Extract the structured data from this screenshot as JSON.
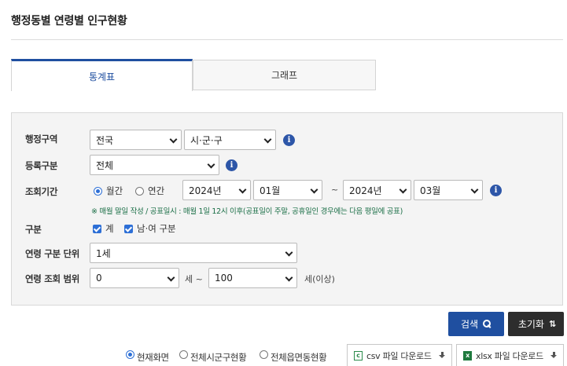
{
  "page": {
    "title": "행정동별 연령별 인구현황"
  },
  "tabs": [
    {
      "label": "통계표",
      "active": true
    },
    {
      "label": "그래프",
      "active": false
    }
  ],
  "filters": {
    "region": {
      "label": "행정구역",
      "sido": "전국",
      "sigungu": "시·군·구"
    },
    "registration": {
      "label": "등록구분",
      "value": "전체"
    },
    "period": {
      "label": "조회기간",
      "options": [
        "월간",
        "연간"
      ],
      "selected": "월간",
      "from_year": "2024년",
      "from_month": "01월",
      "range_sep": "~",
      "to_year": "2024년",
      "to_month": "03월",
      "note": "※ 매월 말일 작성 / 공표일시 : 매월 1일 12시 이후(공표일이 주말, 공휴일인 경우에는 다음 평일에 공표)"
    },
    "division": {
      "label": "구분",
      "options": [
        "계",
        "남·여 구분"
      ],
      "checked": [
        true,
        true
      ]
    },
    "age_unit": {
      "label": "연령 구분 단위",
      "value": "1세"
    },
    "age_range": {
      "label": "연령 조회 범위",
      "from": "0",
      "sep": "세 ~",
      "to": "100",
      "suffix": "세(이상)"
    }
  },
  "buttons": {
    "search": "검색",
    "reset": "초기화"
  },
  "view_options": {
    "items": [
      "현재화면",
      "전체시군구현황",
      "전체읍면동현황"
    ],
    "selected": "현재화면"
  },
  "downloads": [
    {
      "label": "csv 파일 다운로드",
      "icon": "csv-file-icon"
    },
    {
      "label": "xlsx 파일 다운로드",
      "icon": "xlsx-file-icon"
    }
  ],
  "colors": {
    "accent": "#1f4fa0",
    "check": "#2d6fd6",
    "note": "#1a6e46",
    "dark": "#2d2d2d"
  }
}
